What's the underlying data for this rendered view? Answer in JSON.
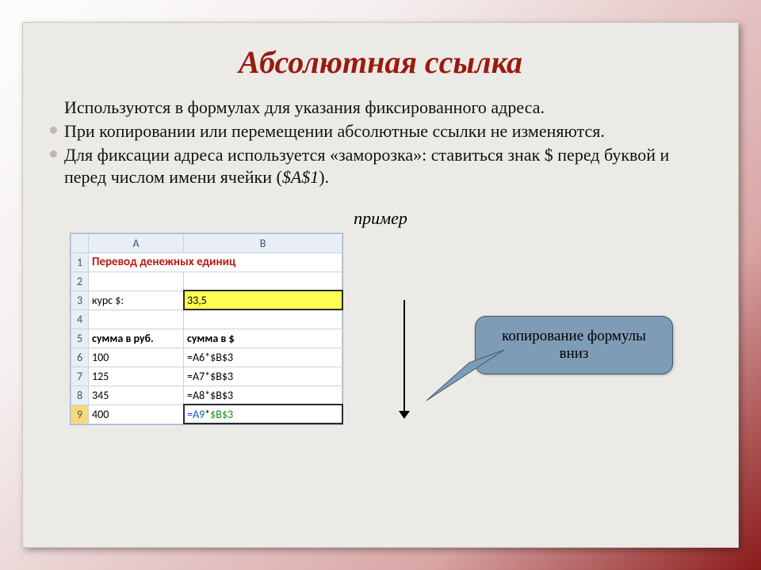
{
  "title": "Абсолютная ссылка",
  "bullets": {
    "b0": "Используются в формулах для указания фиксированного адреса.",
    "b1": "При копировании или перемещении абсолютные ссылки не изменяются.",
    "b2_pre": "Для фиксации адреса используется «заморозка»: ставиться знак $ перед буквой и перед числом имени ячейки (",
    "b2_ref": "$A$1",
    "b2_post": ")."
  },
  "example_label": "пример",
  "sheet": {
    "col_a": "A",
    "col_b": "B",
    "rows": [
      "1",
      "2",
      "3",
      "4",
      "5",
      "6",
      "7",
      "8",
      "9"
    ],
    "merged_title": "Перевод денежных единиц",
    "r3a": "курс $:",
    "r3b": "33,5",
    "r5a": "сумма в руб.",
    "r5b": "сумма в $",
    "r6a": "100",
    "r7a": "125",
    "r8a": "345",
    "r9a": "400",
    "f6_ref": "=A6",
    "f7_ref": "=A7",
    "f8_ref": "=A8",
    "f9_ref": "=A9",
    "star": "*",
    "abs": "$B$3"
  },
  "callout_l1": "копирование формулы",
  "callout_l2": "вниз"
}
